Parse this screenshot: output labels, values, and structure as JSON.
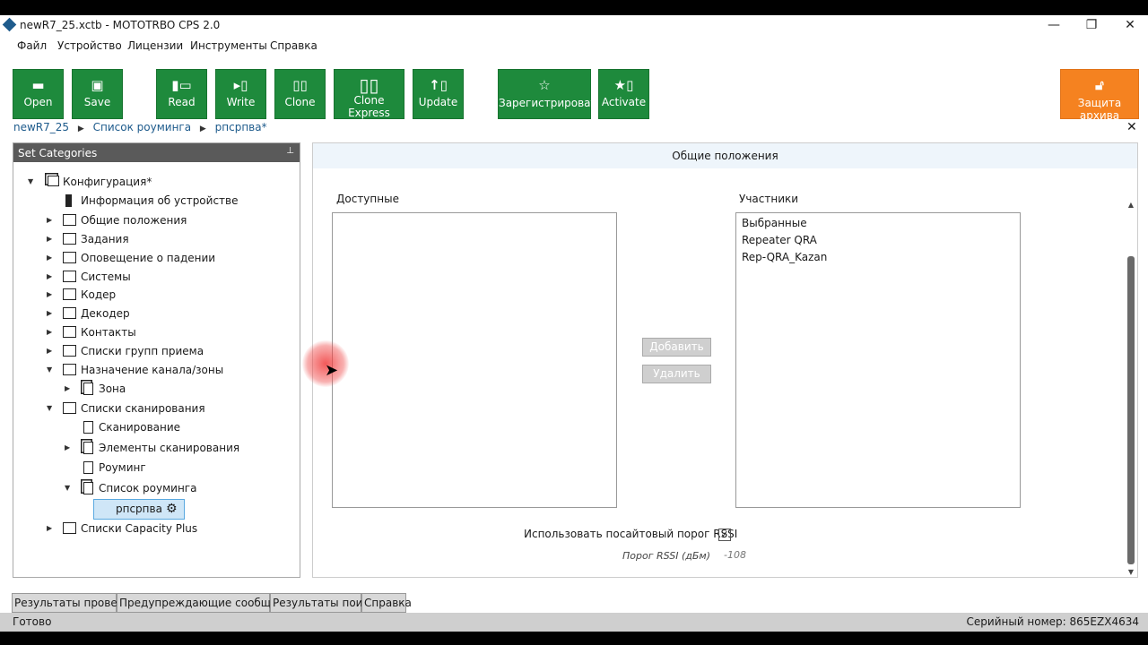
{
  "window": {
    "title": "newR7_25.xctb - MOTOTRBO CPS 2.0",
    "minimize": "—",
    "restore": "❐",
    "close": "✕"
  },
  "menu": [
    "Файл",
    "Устройство",
    "Лицензии",
    "Инструменты",
    "Справка"
  ],
  "toolbar": {
    "open": {
      "label": "Open",
      "icon": "folder-open-icon"
    },
    "save": {
      "label": "Save",
      "icon": "floppy-icon"
    },
    "read": {
      "label": "Read",
      "icon": "read-device-icon"
    },
    "write": {
      "label": "Write",
      "icon": "write-device-icon"
    },
    "clone": {
      "label": "Clone",
      "icon": "clone-icon"
    },
    "clone_express": {
      "label": "Clone Express",
      "icon": "clone-express-icon"
    },
    "update": {
      "label": "Update",
      "icon": "update-icon"
    },
    "register": {
      "label": "Зарегистрировать",
      "icon": "star-icon"
    },
    "activate": {
      "label": "Activate",
      "icon": "activate-icon"
    },
    "archive": {
      "label": "Защита архива",
      "icon": "unlock-icon"
    },
    "colors": {
      "green": "#1e8a3c",
      "orange": "#f58220"
    }
  },
  "breadcrumb": [
    "newR7_25",
    "Список роуминга",
    "рпсрпва*"
  ],
  "left_panel": {
    "title": "Set Categories",
    "tree": {
      "config": "Конфигурация*",
      "device_info": "Информация об устройстве",
      "general": "Общие положения",
      "tasks": "Задания",
      "man_down": "Оповещение о падении",
      "systems": "Системы",
      "coder": "Кодер",
      "decoder": "Декодер",
      "contacts": "Контакты",
      "rx_groups": "Списки групп приема",
      "channel_zone": "Назначение канала/зоны",
      "zone": "Зона",
      "scan_lists": "Списки сканирования",
      "scan": "Сканирование",
      "scan_members": "Элементы сканирования",
      "roaming": "Роуминг",
      "roam_list": "Список роуминга",
      "selected": "рпсрпва",
      "capacity_plus": "Списки Capacity Plus"
    }
  },
  "right_panel": {
    "header": "Общие положения",
    "available_title": "Доступные",
    "members_title": "Участники",
    "members": [
      "Выбранные",
      "Repeater QRA",
      "Rep-QRA_Kazan"
    ],
    "add_button": "Добавить",
    "remove_button": "Удалить",
    "rssi_checkbox_label": "Использовать посайтовый порог RSSI",
    "rssi_checked": "✓",
    "rssi_threshold_label": "Порог RSSI (дБм)",
    "rssi_threshold_value": "-108"
  },
  "bottom_tabs": [
    "Результаты проверки",
    "Предупреждающие сообщения",
    "Результаты поиска",
    "Справка"
  ],
  "status": {
    "left": "Готово",
    "right": "Серийный номер: 865EZX4634"
  }
}
